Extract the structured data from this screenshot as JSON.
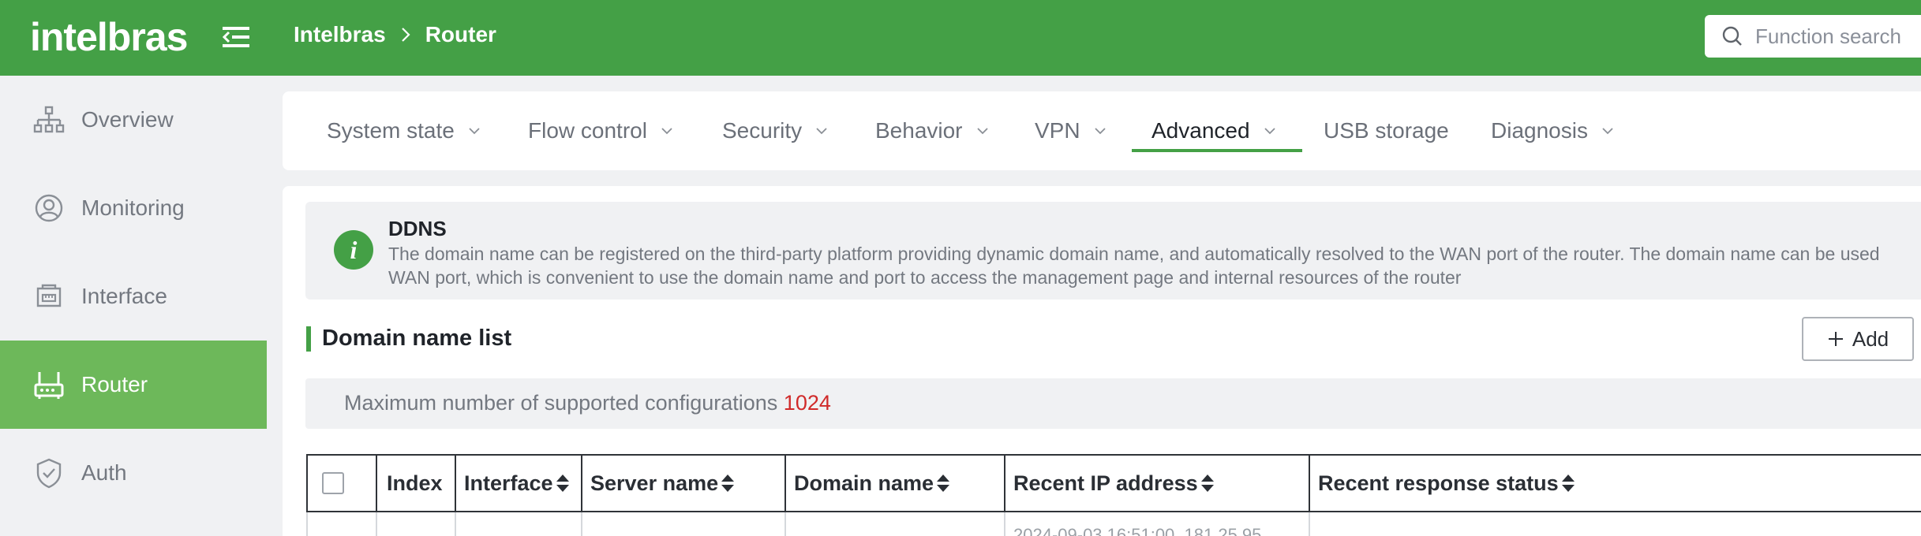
{
  "header": {
    "logo": "intelbras",
    "breadcrumb": [
      "Intelbras",
      "Router"
    ],
    "search_placeholder": "Function search",
    "accent_color": "#44a046"
  },
  "sidebar": {
    "items": [
      {
        "label": "Overview",
        "icon": "sitemap-icon",
        "active": false
      },
      {
        "label": "Monitoring",
        "icon": "user-circle-icon",
        "active": false
      },
      {
        "label": "Interface",
        "icon": "interface-icon",
        "active": false
      },
      {
        "label": "Router",
        "icon": "router-icon",
        "active": true
      },
      {
        "label": "Auth",
        "icon": "shield-check-icon",
        "active": false
      }
    ]
  },
  "tabs": [
    {
      "label": "System state",
      "dropdown": true
    },
    {
      "label": "Flow control",
      "dropdown": true
    },
    {
      "label": "Security",
      "dropdown": true
    },
    {
      "label": "Behavior",
      "dropdown": true
    },
    {
      "label": "VPN",
      "dropdown": true
    },
    {
      "label": "Advanced",
      "dropdown": true,
      "active": true
    },
    {
      "label": "USB storage",
      "dropdown": false
    },
    {
      "label": "Diagnosis",
      "dropdown": true
    }
  ],
  "info": {
    "title": "DDNS",
    "line1": "The domain name can be registered on the third-party platform providing dynamic domain name, and automatically resolved to the WAN port of the router. The domain name can be used",
    "line2": "WAN port, which is convenient to use the domain name and port to access the management page and internal resources of the router"
  },
  "section": {
    "title": "Domain name list",
    "add_label": "Add"
  },
  "max_config": {
    "text": "Maximum number of supported configurations",
    "value": "1024",
    "value_color": "#d02a2a"
  },
  "table": {
    "columns": [
      "Index",
      "Interface",
      "Server name",
      "Domain name",
      "Recent IP address",
      "Recent response status"
    ],
    "partial_row_text": "2024-09-03 16:51:00, 181.25.95"
  }
}
